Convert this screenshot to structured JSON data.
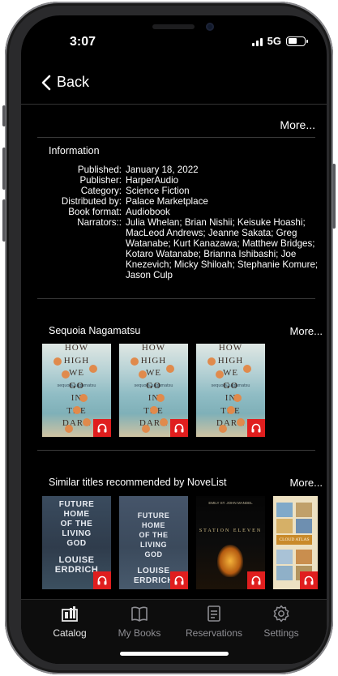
{
  "status_bar": {
    "time": "3:07",
    "network": "5G"
  },
  "nav": {
    "back_label": "Back"
  },
  "top_more": "More...",
  "information": {
    "title": "Information",
    "rows": [
      {
        "label": "Published:",
        "value": "January 18, 2022"
      },
      {
        "label": "Publisher:",
        "value": "HarperAudio"
      },
      {
        "label": "Category:",
        "value": "Science Fiction"
      },
      {
        "label": "Distributed by:",
        "value": "Palace Marketplace"
      },
      {
        "label": "Book format:",
        "value": "Audiobook"
      },
      {
        "label": "Narrators::",
        "value": "Julia Whelan; Brian Nishii; Keisuke Hoashi; MacLeod Andrews; Jeanne Sakata; Greg Watanabe; Kurt Kanazawa; Matthew Bridges; Kotaro Watanabe; Brianna Ishibashi; Joe Knezevich; Micky Shiloah; Stephanie Komure; Jason Culp"
      }
    ]
  },
  "author_section": {
    "title": "Sequoia Nagamatsu",
    "more": "More...",
    "books": [
      {
        "cover_lines": [
          "HOW",
          "HIGH",
          "WE",
          "GO",
          "IN",
          "THE",
          "DARK"
        ],
        "author": "sequoia nagamatsu",
        "badge": "headphones-icon"
      },
      {
        "cover_lines": [
          "HOW",
          "HIGH",
          "WE",
          "GO",
          "IN",
          "THE",
          "DARK"
        ],
        "author": "sequoia nagamatsu",
        "badge": "headphones-icon"
      },
      {
        "cover_lines": [
          "HOW",
          "HIGH",
          "WE",
          "GO",
          "IN",
          "THE",
          "DARK"
        ],
        "author": "sequoia nagamatsu",
        "badge": "headphones-icon"
      }
    ]
  },
  "similar_section": {
    "title": "Similar titles recommended by NoveList",
    "more": "More...",
    "books": [
      {
        "cover_lines": [
          "FUTURE",
          "HOME",
          "OF THE",
          "LIVING",
          "GOD",
          "LOUISE",
          "ERDRICH"
        ],
        "badge": "headphones-icon"
      },
      {
        "cover_lines": [
          "FUTURE",
          "HOME",
          "OF THE",
          "LIVING",
          "GOD",
          "LOUISE",
          "ERDRICH"
        ],
        "badge": "headphones-icon"
      },
      {
        "cover_lines": [
          "EMILY ST. JOHN MANDEL",
          "STATION ELEVEN"
        ],
        "badge": "headphones-icon"
      },
      {
        "cover_lines": [
          "CLOUD ATLAS"
        ],
        "badge": "headphones-icon"
      }
    ]
  },
  "tabs": [
    {
      "label": "Catalog",
      "icon": "catalog-icon",
      "active": true
    },
    {
      "label": "My Books",
      "icon": "book-icon",
      "active": false
    },
    {
      "label": "Reservations",
      "icon": "reservations-icon",
      "active": false
    },
    {
      "label": "Settings",
      "icon": "gear-icon",
      "active": false
    }
  ],
  "colors": {
    "background": "#000000",
    "badge": "#e01e1e",
    "tab_inactive": "#8e8e93"
  }
}
